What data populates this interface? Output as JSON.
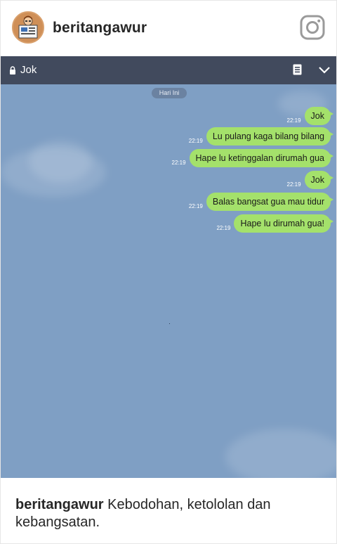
{
  "ig": {
    "username": "beritangawur",
    "icon": "instagram-icon"
  },
  "chat": {
    "title": "Jok",
    "date_label": "Hari Ini",
    "messages": [
      {
        "time": "22:19",
        "text": "Jok"
      },
      {
        "time": "22:19",
        "text": "Lu pulang kaga bilang bilang"
      },
      {
        "time": "22:19",
        "text": "Hape lu ketinggalan dirumah gua"
      },
      {
        "time": "22:19",
        "text": "Jok"
      },
      {
        "time": "22:19",
        "text": "Balas bangsat gua mau tidur"
      },
      {
        "time": "22:19",
        "text": "Hape lu dirumah gua!"
      }
    ],
    "colors": {
      "background": "#7f9fc4",
      "bar": "#414a5d",
      "bubble": "#a4e16b"
    }
  },
  "caption": {
    "username": "beritangawur",
    "text": " Kebodohan, ketololan dan kebangsatan."
  }
}
